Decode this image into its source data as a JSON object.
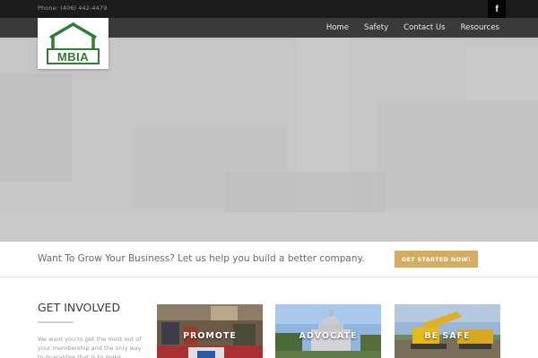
{
  "topbar": {
    "phone": "Phone: (406) 442-4479",
    "social_icon": "facebook-icon",
    "social_glyph": "f"
  },
  "logo": {
    "text": "MBIA",
    "brand_color": "#2e7d32"
  },
  "nav": {
    "items": [
      {
        "label": "Home"
      },
      {
        "label": "Safety"
      },
      {
        "label": "Contact Us"
      },
      {
        "label": "Resources"
      }
    ]
  },
  "cta": {
    "text": "Want To Grow Your Business? Let us help you build a better company.",
    "button_label": "GET STARTED NOW!",
    "button_color": "#d4ac62"
  },
  "involved": {
    "title": "GET INVOLVED",
    "body": "We want you to get the most out of your membership and the only way to guarantee that is to make"
  },
  "tiles": [
    {
      "label": "PROMOTE"
    },
    {
      "label": "ADVOCATE"
    },
    {
      "label": "BE SAFE"
    }
  ]
}
